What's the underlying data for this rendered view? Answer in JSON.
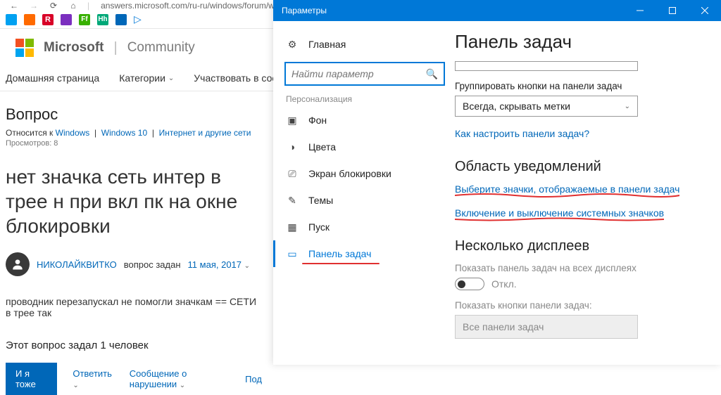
{
  "browser": {
    "url": "answers.microsoft.com/ru-ru/windows/forum/w",
    "brand": "Microsoft",
    "community": "Community",
    "nav": {
      "home": "Домашняя страница",
      "categories": "Категории",
      "participate": "Участвовать в сообщес"
    },
    "question": {
      "label": "Вопрос",
      "relates_prefix": "Относится к",
      "link1": "Windows",
      "separator": "|",
      "link2": "Windows 10",
      "link3": "Интернет и другие сети",
      "views": "Просмотров: 8",
      "title": "нет значка сеть интер в трее н при вкл пк на окне блокировки",
      "user": "НИКОЛАЙКВИТКО",
      "asked": "вопрос задан",
      "date": "11 мая, 2017",
      "body": "проводник перезапускал не помогли значкам == СЕТИ в трее так",
      "also": "Этот вопрос задал 1 человек",
      "me_too": "И я тоже",
      "reply": "Ответить",
      "report": "Сообщение о нарушении",
      "sub": "Под"
    }
  },
  "settings": {
    "window_title": "Параметры",
    "nav": {
      "home": "Главная",
      "search_placeholder": "Найти параметр",
      "section": "Персонализация",
      "items": [
        "Фон",
        "Цвета",
        "Экран блокировки",
        "Темы",
        "Пуск",
        "Панель задач"
      ]
    },
    "page": {
      "title": "Панель задач",
      "group_label": "Группировать кнопки на панели задач",
      "group_value": "Всегда, скрывать метки",
      "howto": "Как настроить панели задач?",
      "notif_title": "Область уведомлений",
      "notif_link1": "Выберите значки, отображаемые в панели задач",
      "notif_link2": "Включение и выключение системных значков",
      "multi_title": "Несколько дисплеев",
      "multi_label": "Показать панель задач на всех дисплеях",
      "toggle_off": "Откл.",
      "show_buttons": "Показать кнопки панели задач:",
      "all_panels": "Все панели задач"
    }
  }
}
